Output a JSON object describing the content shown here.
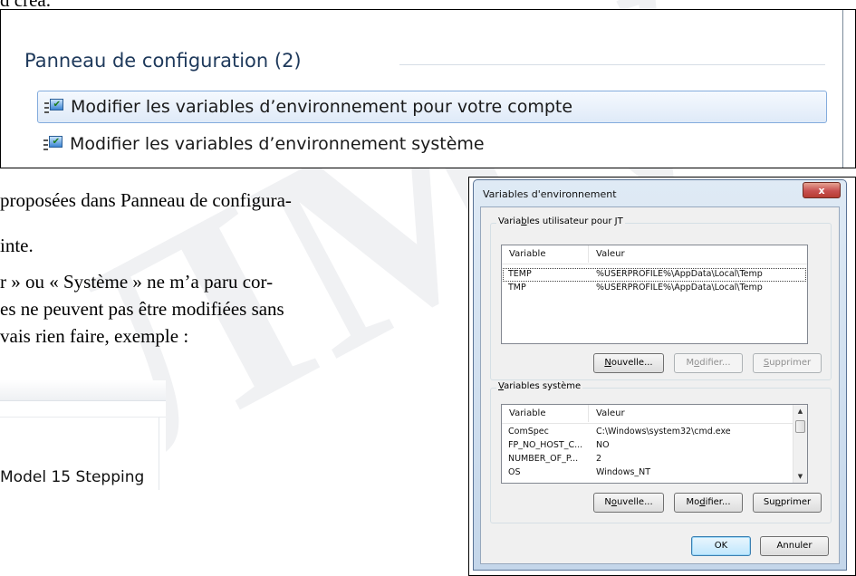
{
  "watermark": "ЛМV",
  "top_fragment": "d créa.",
  "search_panel": {
    "heading": "Panneau de configuration (2)",
    "results": [
      {
        "label": "Modifier les variables d’environnement pour votre compte",
        "icon": "control-panel-icon",
        "selected": true
      },
      {
        "label": "Modifier les variables d’environnement système",
        "icon": "control-panel-icon",
        "selected": false
      }
    ]
  },
  "doc_lines": [
    "proposées dans Panneau de configura-",
    "inte.",
    "r » ou « Système » ne m’a paru cor-",
    "es ne peuvent pas être modifiées sans",
    "vais rien faire, exemple :"
  ],
  "cpu_fragment": {
    "text": "Model 15 Stepping"
  },
  "dialog": {
    "title": "Variables d'environnement",
    "close_label": "x",
    "user_group": {
      "label_pre": "Varia",
      "label_u": "b",
      "label_post": "les utilisateur pour JT",
      "col_variable": "Variable",
      "col_value": "Valeur",
      "rows": [
        {
          "name": "TEMP",
          "value": "%USERPROFILE%\\AppData\\Local\\Temp"
        },
        {
          "name": "TMP",
          "value": "%USERPROFILE%\\AppData\\Local\\Temp"
        }
      ],
      "btn_new": {
        "pre": "",
        "u": "N",
        "post": "ouvelle..."
      },
      "btn_edit": {
        "pre": "M",
        "u": "o",
        "post": "difier..."
      },
      "btn_delete": {
        "pre": "",
        "u": "S",
        "post": "upprimer"
      }
    },
    "system_group": {
      "label_pre": "",
      "label_u": "V",
      "label_post": "ariables système",
      "col_variable": "Variable",
      "col_value": "Valeur",
      "rows": [
        {
          "name": "ComSpec",
          "value": "C:\\Windows\\system32\\cmd.exe"
        },
        {
          "name": "FP_NO_HOST_C...",
          "value": "NO"
        },
        {
          "name": "NUMBER_OF_P...",
          "value": "2"
        },
        {
          "name": "OS",
          "value": "Windows_NT"
        }
      ],
      "btn_new": {
        "pre": "N",
        "u": "o",
        "post": "uvelle..."
      },
      "btn_edit": {
        "pre": "Mo",
        "u": "d",
        "post": "ifier..."
      },
      "btn_delete": {
        "pre": "Su",
        "u": "p",
        "post": "primer"
      }
    },
    "ok_label": "OK",
    "cancel_label": "Annuler"
  },
  "colors": {
    "heading": "#1e395b",
    "selection_border": "#84acdd",
    "dialog_frame": "#dfeaf5",
    "close_button": "#c75050"
  }
}
